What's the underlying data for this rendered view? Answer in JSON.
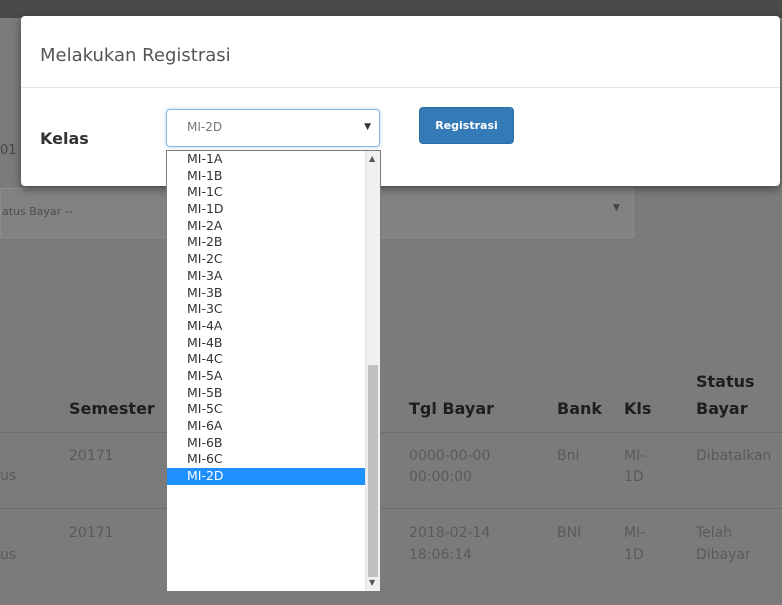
{
  "background": {
    "topbar_fragments": [
      "",
      "",
      "",
      ""
    ],
    "clipped_text": "01",
    "filter_placeholder": "atus Bayar --",
    "table": {
      "headers": {
        "semester": "Semester",
        "tgl_bayar": "Tgl Bayar",
        "bank": "Bank",
        "kls": "Kls",
        "status_line1": "Status",
        "status_line2": "Bayar"
      },
      "rows": [
        {
          "left_fragment": "us",
          "semester": "20171",
          "tgl_line1": "0000-00-00",
          "tgl_line2": "00:00:00",
          "bank": "Bni",
          "kls_line1": "MI-",
          "kls_line2": "1D",
          "status_line1": "Dibatalkan",
          "status_line2": ""
        },
        {
          "left_fragment": "us",
          "semester": "20171",
          "tgl_line1": "2018-02-14",
          "tgl_line2": "18:06:14",
          "bank": "BNI",
          "kls_line1": "MI-",
          "kls_line2": "1D",
          "status_line1": "Telah",
          "status_line2": "Dibayar"
        }
      ]
    }
  },
  "modal": {
    "title": "Melakukan Registrasi",
    "kelas_label": "Kelas",
    "select_value": "MI-2D",
    "register_button": "Registrasi",
    "options": [
      "MI-1A",
      "MI-1B",
      "MI-1C",
      "MI-1D",
      "MI-2A",
      "MI-2B",
      "MI-2C",
      "MI-3A",
      "MI-3B",
      "MI-3C",
      "MI-4A",
      "MI-4B",
      "MI-4C",
      "MI-5A",
      "MI-5B",
      "MI-5C",
      "MI-6A",
      "MI-6B",
      "MI-6C",
      "MI-2D"
    ],
    "selected_option": "MI-2D"
  },
  "colors": {
    "primary": "#337ab7",
    "highlight": "#1e90ff"
  }
}
